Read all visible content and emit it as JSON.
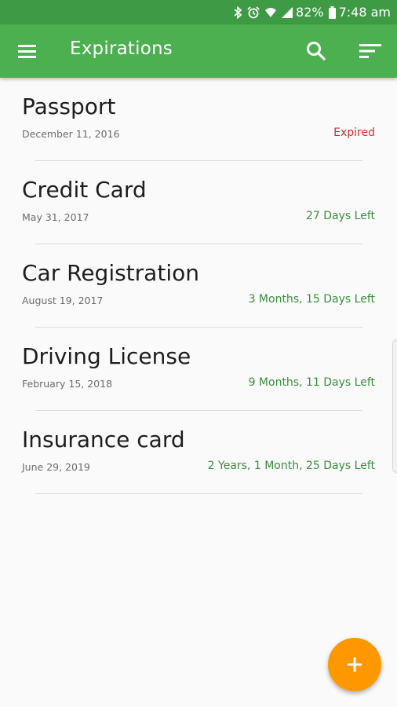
{
  "status_bar": {
    "battery_percent": "82%",
    "time": "7:48 am",
    "icons": [
      "bluetooth-icon",
      "alarm-icon",
      "wifi-icon",
      "signal-icon",
      "battery-icon"
    ]
  },
  "app_bar": {
    "title": "Expirations",
    "icons": [
      "menu-icon",
      "search-icon",
      "sort-icon"
    ]
  },
  "items": [
    {
      "name": "Passport",
      "date": "December 11, 2016",
      "status": "Expired",
      "status_type": "expired"
    },
    {
      "name": "Credit Card",
      "date": "May 31, 2017",
      "status": "27 Days Left",
      "status_type": "active"
    },
    {
      "name": "Car Registration",
      "date": "August 19, 2017",
      "status": "3 Months, 15 Days Left",
      "status_type": "active"
    },
    {
      "name": "Driving License",
      "date": "February 15, 2018",
      "status": "9 Months, 11 Days Left",
      "status_type": "active"
    },
    {
      "name": "Insurance card",
      "date": "June 29, 2019",
      "status": "2 Years, 1 Month, 25 Days Left",
      "status_type": "active"
    }
  ],
  "fab": {
    "icon": "plus-icon"
  },
  "colors": {
    "status_bar": "#3f9a45",
    "app_bar": "#4caf50",
    "expired": "#d32f2f",
    "active": "#388e3c",
    "fab": "#ff9800"
  }
}
